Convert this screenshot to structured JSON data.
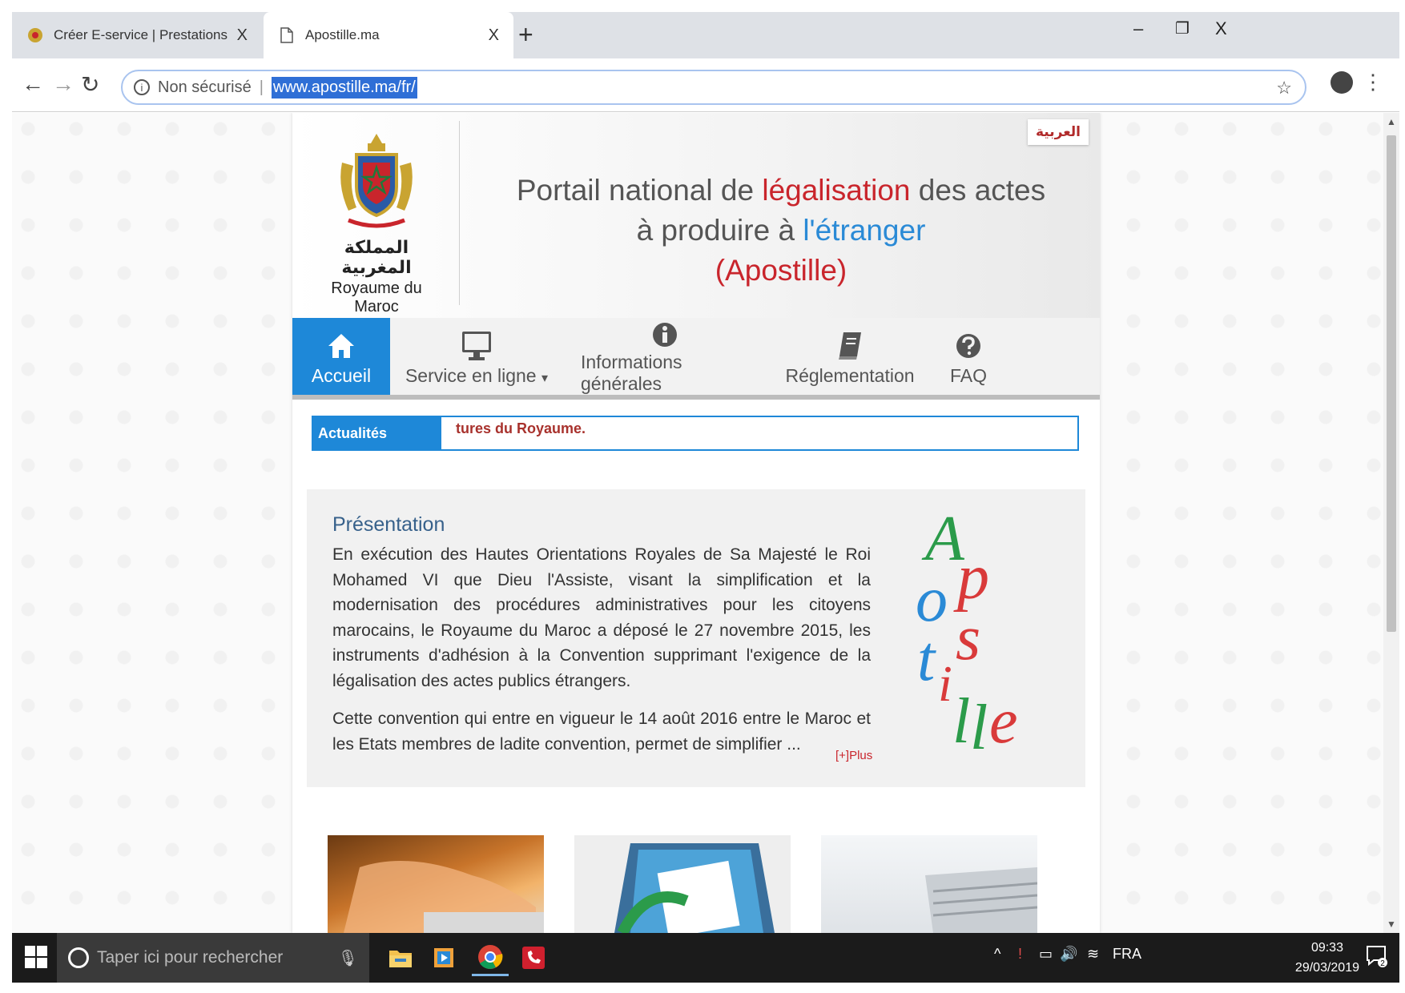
{
  "browser": {
    "tabs": [
      {
        "title": "Créer E-service | Prestations Cons",
        "active": false
      },
      {
        "title": "Apostille.ma",
        "active": true
      }
    ],
    "new_tab_label": "+",
    "close_label": "X",
    "window_controls": {
      "minimize": "–",
      "restore": "❐",
      "close": "X"
    },
    "nav": {
      "back": "←",
      "forward": "→",
      "reload": "↻"
    },
    "security_label": "Non sécurisé",
    "url": "www.apostille.ma/fr/",
    "bookmark_star": "☆",
    "menu": "⋮"
  },
  "site": {
    "lang_link": "العربية",
    "logo_ar": "المملكة المغربية",
    "logo_fr": "Royaume du Maroc",
    "title": {
      "part1": "Portail national de ",
      "highlight1": "légalisation",
      "part2": " des actes",
      "line2_part": "à produire à ",
      "highlight2": "l'étranger",
      "line3": "(Apostille)"
    },
    "nav_items": [
      {
        "label": "Accueil",
        "icon": "home-icon",
        "active": true
      },
      {
        "label": "Service en ligne",
        "icon": "monitor-icon",
        "dropdown": "▾"
      },
      {
        "label": "Informations générales",
        "icon": "info-icon"
      },
      {
        "label": "Réglementation",
        "icon": "book-icon"
      },
      {
        "label": "FAQ",
        "icon": "question-icon"
      }
    ],
    "ticker": {
      "label": "Actualités",
      "text": "tures du Royaume."
    },
    "presentation": {
      "heading": "Présentation",
      "para1": "En exécution des Hautes Orientations Royales de Sa Majesté le Roi Mohamed VI que Dieu l'Assiste, visant la simplification et la modernisation des procédures administratives pour les citoyens marocains, le Royaume du Maroc a déposé le 27 novembre 2015, les instruments d'adhésion à la Convention supprimant l'exigence de la légalisation des actes publics étrangers.",
      "para2": "Cette convention qui entre en vigueur le 14 août 2016 entre le Maroc et les Etats membres de ladite convention, permet de simplifier ...",
      "more": "[+]Plus",
      "logo_letters": [
        "A",
        "p",
        "o",
        "s",
        "t",
        "i",
        "l",
        "l",
        "e"
      ]
    }
  },
  "taskbar": {
    "search_placeholder": "Taper ici pour rechercher",
    "language": "FRA",
    "time": "09:33",
    "date": "29/03/2019",
    "notifications": "2"
  },
  "colors": {
    "accent": "#1e88d8",
    "brand_red": "#c9252c",
    "brand_blue": "#2a8ad6"
  }
}
